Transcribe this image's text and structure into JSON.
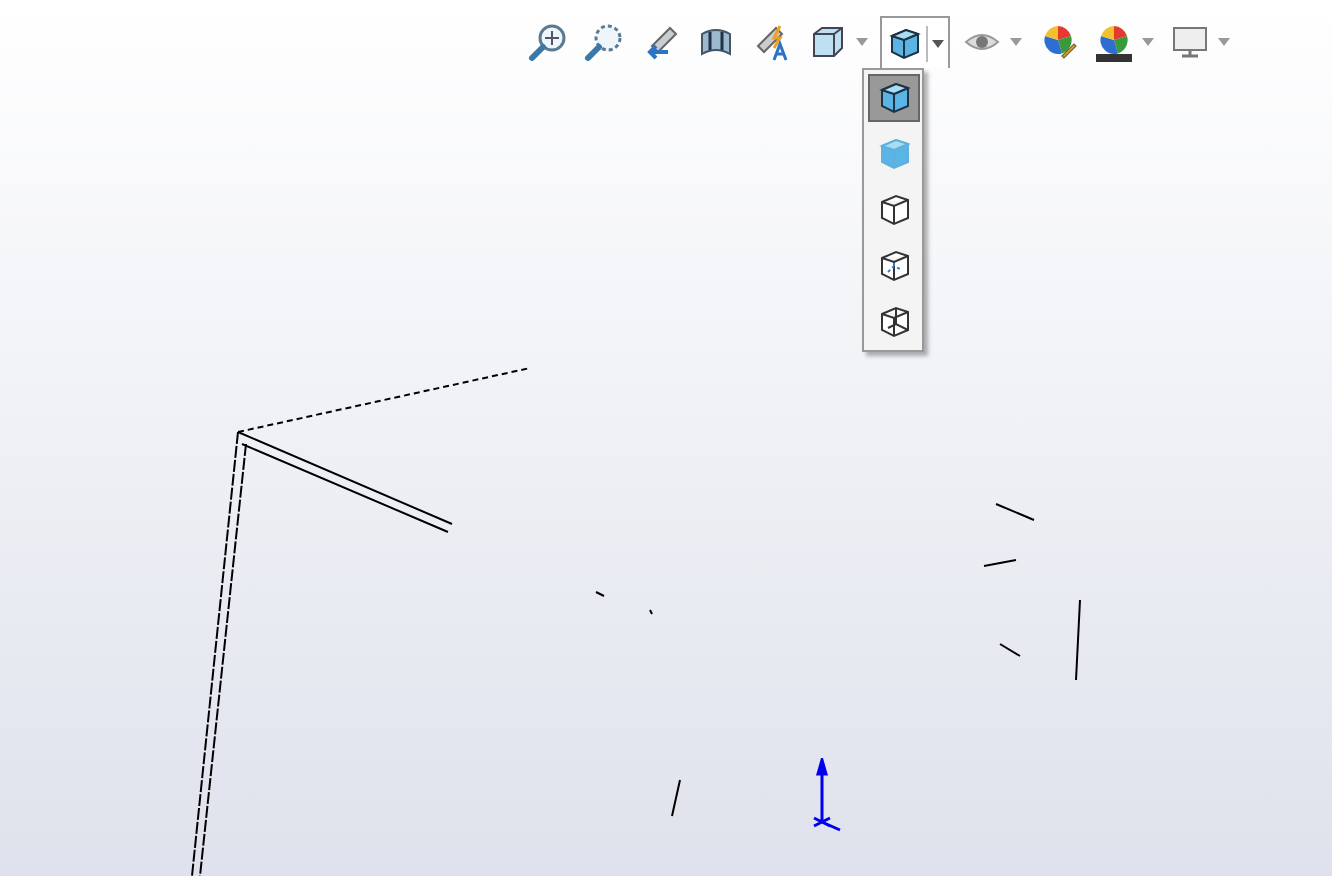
{
  "toolbar": {
    "buttons": [
      {
        "kind": "zoom-fit",
        "caret": false,
        "pressed": false
      },
      {
        "kind": "zoom-area",
        "caret": false,
        "pressed": false
      },
      {
        "kind": "previous-view",
        "caret": false,
        "pressed": false
      },
      {
        "kind": "section",
        "caret": false,
        "pressed": false
      },
      {
        "kind": "annotation",
        "caret": false,
        "pressed": false
      },
      {
        "kind": "orientation",
        "caret": true,
        "pressed": false
      },
      {
        "kind": "display-style",
        "caret": true,
        "pressed": true
      },
      {
        "kind": "hide-show",
        "caret": true,
        "pressed": false
      },
      {
        "kind": "appearance",
        "caret": false,
        "pressed": false
      },
      {
        "kind": "scene",
        "caret": true,
        "pressed": false
      },
      {
        "kind": "view-settings",
        "caret": true,
        "pressed": false
      }
    ]
  },
  "display_style_menu": {
    "items": [
      {
        "kind": "shaded-edges",
        "selected": true
      },
      {
        "kind": "shaded",
        "selected": false
      },
      {
        "kind": "hidden-removed",
        "selected": false
      },
      {
        "kind": "hidden-visible",
        "selected": false
      },
      {
        "kind": "wireframe",
        "selected": false
      }
    ]
  }
}
